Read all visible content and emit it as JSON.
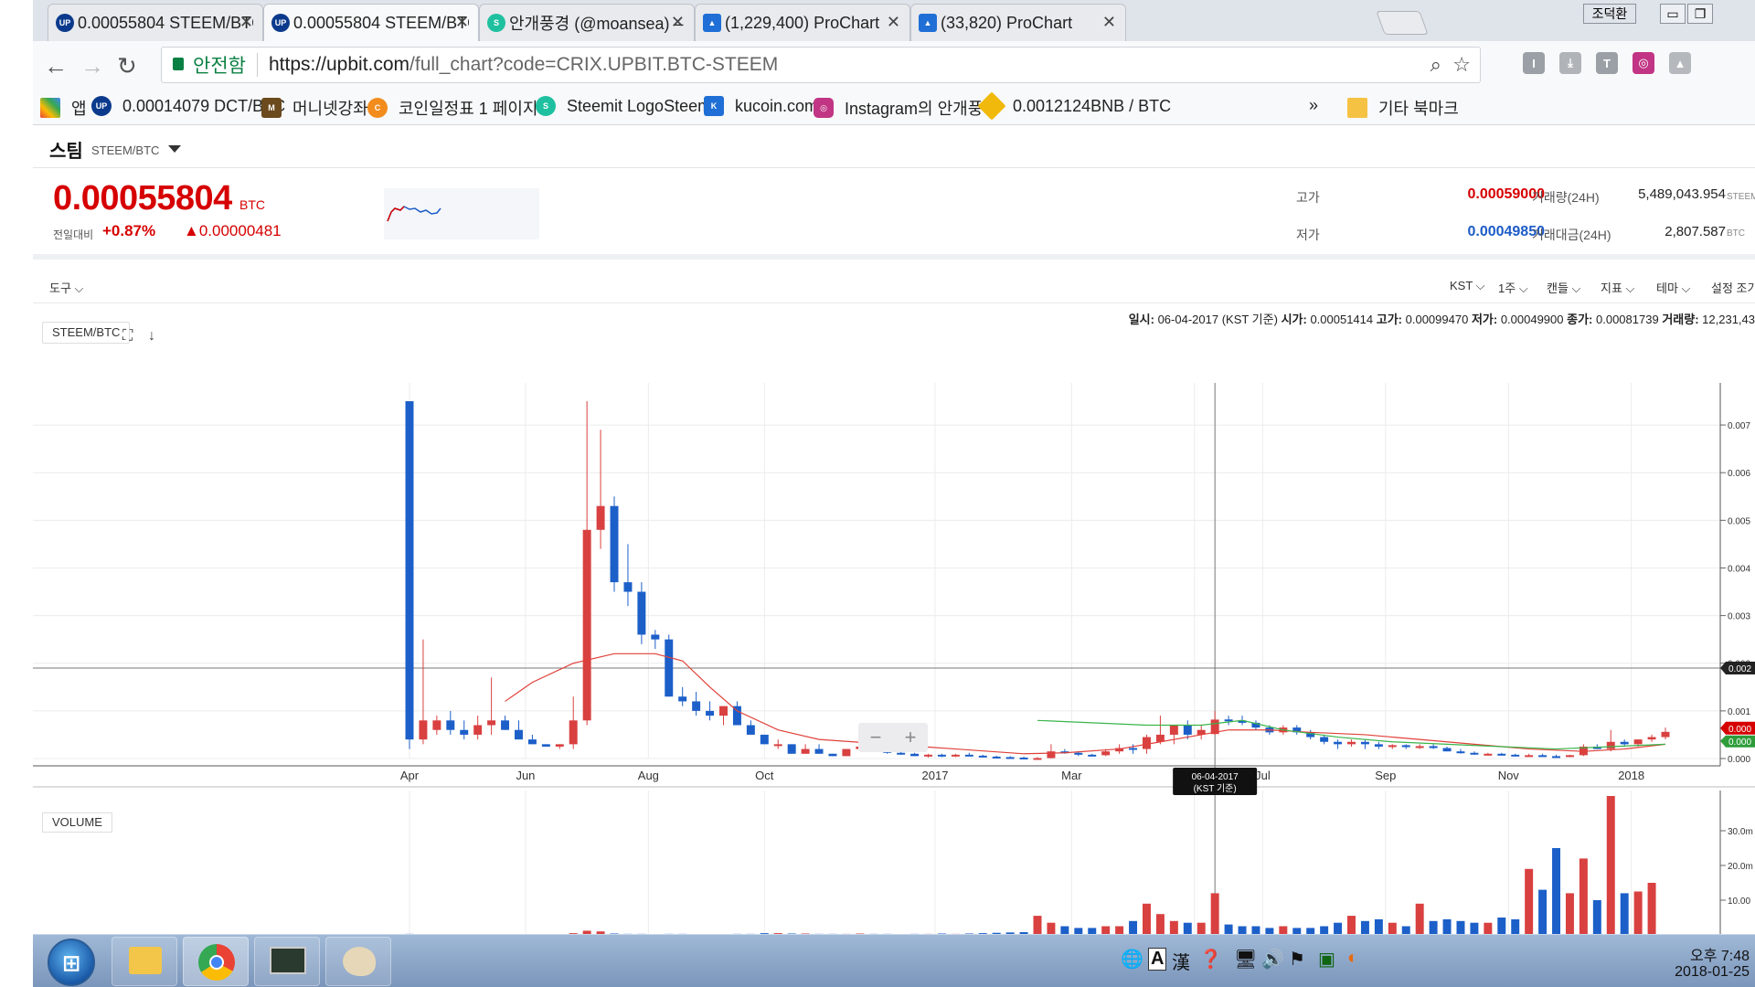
{
  "browser": {
    "tabs": [
      {
        "title": "0.00055804 STEEM/BTC",
        "icon": "upbit-icon",
        "active": false
      },
      {
        "title": "0.00055804 STEEM/BTC",
        "icon": "upbit-icon",
        "active": true
      },
      {
        "title": "안개풍경 (@moansea) –",
        "icon": "steemit-icon",
        "active": false
      },
      {
        "title": "(1,229,400) ProChart",
        "icon": "prochart-icon",
        "active": false
      },
      {
        "title": "(33,820) ProChart",
        "icon": "prochart-icon",
        "active": false
      }
    ],
    "user_badge": "조덕환",
    "secure_label": "안전함",
    "url_host": "https://upbit.com",
    "url_path": "/full_chart?code=CRIX.UPBIT.BTC-STEEM",
    "bookmarks": [
      {
        "label": "앱",
        "icon": "apps-grid-icon"
      },
      {
        "label": "0.00014079 DCT/BTC",
        "icon": "upbit-icon"
      },
      {
        "label": "머니넷강좌",
        "icon": "moneynet-icon"
      },
      {
        "label": "코인일정표 1 페이지",
        "icon": "coin-schedule-icon"
      },
      {
        "label": "Steemit LogoSteemit",
        "icon": "steemit-icon"
      },
      {
        "label": "kucoin.com",
        "icon": "kucoin-icon"
      },
      {
        "label": "Instagram의 안개풍경",
        "icon": "instagram-icon"
      },
      {
        "label": "0.0012124BNB / BTC",
        "icon": "binance-icon"
      }
    ],
    "bookmarks_overflow": "»",
    "other_bookmarks": "기타 북마크"
  },
  "coin": {
    "name": "스팀",
    "pair": "STEEM/BTC",
    "price": "0.00055804",
    "price_unit": "BTC",
    "change_label": "전일대비",
    "change_pct": "+0.87%",
    "change_abs": "▲0.00000481",
    "high_label": "고가",
    "high": "0.00059000",
    "low_label": "저가",
    "low": "0.00049850",
    "volume_label": "거래량(24H)",
    "volume": "5,489,043.954",
    "volume_unit": "STEEM",
    "value_label": "거래대금(24H)",
    "value": "2,807.587",
    "value_unit": "BTC"
  },
  "chart_toolbar": {
    "tools": "도구",
    "timezone": "KST",
    "interval": "1주",
    "candle": "캔들",
    "indicators": "지표",
    "theme": "테마",
    "settings": "설정 조기화"
  },
  "info_line": {
    "date_label": "일시:",
    "date": "06-04-2017 (KST 기준)",
    "open_label": "시가:",
    "open": "0.00051414",
    "high_label": "고가:",
    "high": "0.00099470",
    "low_label": "저가:",
    "low": "0.00049900",
    "close_label": "종가:",
    "close": "0.00081739",
    "vol_label": "거래량:",
    "vol": "12,231,43"
  },
  "symbol_button": "STEEM/BTC",
  "volume_button": "VOLUME",
  "crosshair_date": "06-04-2017",
  "crosshair_tz": "(KST 기준)",
  "crosshair_price": "0.002",
  "last_price_tag": "0.000",
  "colors": {
    "up": "#d94040",
    "down": "#1c5fc9",
    "ma_red": "#e0413a",
    "ma_green": "#39b54a",
    "price_red": "#d60000",
    "price_blue": "#1d5cc7"
  },
  "chart_data": {
    "type": "candlestick",
    "x_tick_labels": [
      "Apr",
      "Jun",
      "Aug",
      "Oct",
      "2017",
      "Mar",
      "May",
      "Jul",
      "Sep",
      "Nov",
      "2018"
    ],
    "y_tick_labels": [
      "0.007",
      "0.006",
      "0.005",
      "0.004",
      "0.003",
      "0.002",
      "0.001",
      "0.000"
    ],
    "ylim": [
      0,
      0.0075
    ],
    "volume_tick_labels": [
      "30.0m",
      "20.0m",
      "10.00"
    ],
    "candles": [
      {
        "o": 0.0075,
        "h": 0.0075,
        "l": 0.0002,
        "c": 0.0004
      },
      {
        "o": 0.0004,
        "h": 0.0025,
        "l": 0.0003,
        "c": 0.0008
      },
      {
        "o": 0.0006,
        "h": 0.0009,
        "l": 0.0005,
        "c": 0.0008
      },
      {
        "o": 0.0008,
        "h": 0.001,
        "l": 0.0005,
        "c": 0.0006
      },
      {
        "o": 0.0006,
        "h": 0.0008,
        "l": 0.0004,
        "c": 0.0005
      },
      {
        "o": 0.0005,
        "h": 0.0009,
        "l": 0.0004,
        "c": 0.0007
      },
      {
        "o": 0.0007,
        "h": 0.0017,
        "l": 0.0005,
        "c": 0.0008
      },
      {
        "o": 0.0008,
        "h": 0.0009,
        "l": 0.0006,
        "c": 0.0006
      },
      {
        "o": 0.0006,
        "h": 0.0008,
        "l": 0.0004,
        "c": 0.0004
      },
      {
        "o": 0.0004,
        "h": 0.0005,
        "l": 0.0003,
        "c": 0.0003
      },
      {
        "o": 0.0003,
        "h": 0.0003,
        "l": 0.00025,
        "c": 0.00025
      },
      {
        "o": 0.00025,
        "h": 0.0003,
        "l": 0.0002,
        "c": 0.0003
      },
      {
        "o": 0.0003,
        "h": 0.0013,
        "l": 0.0002,
        "c": 0.0008
      },
      {
        "o": 0.0008,
        "h": 0.0075,
        "l": 0.0007,
        "c": 0.0048
      },
      {
        "o": 0.0048,
        "h": 0.0069,
        "l": 0.0044,
        "c": 0.0053
      },
      {
        "o": 0.0053,
        "h": 0.0055,
        "l": 0.0035,
        "c": 0.0037
      },
      {
        "o": 0.0037,
        "h": 0.0045,
        "l": 0.0032,
        "c": 0.0035
      },
      {
        "o": 0.0035,
        "h": 0.0037,
        "l": 0.0024,
        "c": 0.0026
      },
      {
        "o": 0.0026,
        "h": 0.0027,
        "l": 0.0023,
        "c": 0.0025
      },
      {
        "o": 0.0025,
        "h": 0.0026,
        "l": 0.0013,
        "c": 0.0013
      },
      {
        "o": 0.0013,
        "h": 0.0015,
        "l": 0.0011,
        "c": 0.0012
      },
      {
        "o": 0.0012,
        "h": 0.0014,
        "l": 0.0009,
        "c": 0.001
      },
      {
        "o": 0.001,
        "h": 0.0012,
        "l": 0.0008,
        "c": 0.0009
      },
      {
        "o": 0.0009,
        "h": 0.0011,
        "l": 0.0007,
        "c": 0.0011
      },
      {
        "o": 0.0011,
        "h": 0.0012,
        "l": 0.0007,
        "c": 0.0007
      },
      {
        "o": 0.0007,
        "h": 0.0008,
        "l": 0.0005,
        "c": 0.0005
      },
      {
        "o": 0.0005,
        "h": 0.0005,
        "l": 0.0003,
        "c": 0.0003
      },
      {
        "o": 0.0003,
        "h": 0.0004,
        "l": 0.0002,
        "c": 0.0003
      },
      {
        "o": 0.0003,
        "h": 0.0003,
        "l": 0.0001,
        "c": 0.0001
      },
      {
        "o": 0.0001,
        "h": 0.0003,
        "l": 0.0001,
        "c": 0.0002
      },
      {
        "o": 0.0002,
        "h": 0.0003,
        "l": 0.0001,
        "c": 0.0001
      },
      {
        "o": 0.0001,
        "h": 0.0001,
        "l": 5e-05,
        "c": 5e-05
      },
      {
        "o": 5e-05,
        "h": 0.0002,
        "l": 5e-05,
        "c": 0.0002
      },
      {
        "o": 0.0002,
        "h": 0.0003,
        "l": 0.00015,
        "c": 0.00025
      },
      {
        "o": 0.00025,
        "h": 0.0003,
        "l": 0.00015,
        "c": 0.0002
      },
      {
        "o": 0.0002,
        "h": 0.0002,
        "l": 0.0001,
        "c": 0.00012
      },
      {
        "o": 0.00012,
        "h": 0.00015,
        "l": 8e-05,
        "c": 0.0001
      },
      {
        "o": 0.0001,
        "h": 0.00012,
        "l": 5e-05,
        "c": 5e-05
      },
      {
        "o": 5e-05,
        "h": 0.0001,
        "l": 2e-05,
        "c": 8e-05
      },
      {
        "o": 8e-05,
        "h": 0.0001,
        "l": 3e-05,
        "c": 5e-05
      },
      {
        "o": 5e-05,
        "h": 0.0001,
        "l": 3e-05,
        "c": 8e-05
      },
      {
        "o": 8e-05,
        "h": 0.00012,
        "l": 5e-05,
        "c": 6e-05
      },
      {
        "o": 6e-05,
        "h": 8e-05,
        "l": 3e-05,
        "c": 4e-05
      },
      {
        "o": 4e-05,
        "h": 6e-05,
        "l": 0.0,
        "c": 3e-05
      },
      {
        "o": 3e-05,
        "h": 5e-05,
        "l": 0.0,
        "c": 2e-05
      },
      {
        "o": 2e-05,
        "h": 4e-05,
        "l": 0.0,
        "c": 1e-05
      },
      {
        "o": 1e-05,
        "h": 3e-05,
        "l": 0.0,
        "c": 1e-05
      },
      {
        "o": 1e-05,
        "h": 0.0003,
        "l": 0.0,
        "c": 0.00015
      },
      {
        "o": 0.00015,
        "h": 0.0002,
        "l": 0.0001,
        "c": 0.00012
      },
      {
        "o": 0.00012,
        "h": 0.00015,
        "l": 5e-05,
        "c": 8e-05
      },
      {
        "o": 8e-05,
        "h": 0.0001,
        "l": 5e-05,
        "c": 7e-05
      },
      {
        "o": 7e-05,
        "h": 0.0002,
        "l": 5e-05,
        "c": 0.00015
      },
      {
        "o": 0.00015,
        "h": 0.0003,
        "l": 0.0001,
        "c": 0.00022
      },
      {
        "o": 0.00022,
        "h": 0.0003,
        "l": 0.0001,
        "c": 0.0002
      },
      {
        "o": 0.0002,
        "h": 0.0005,
        "l": 0.0001,
        "c": 0.00045
      },
      {
        "o": 0.00035,
        "h": 0.0009,
        "l": 0.0003,
        "c": 0.0005
      },
      {
        "o": 0.0005,
        "h": 0.0007,
        "l": 0.0003,
        "c": 0.0007
      },
      {
        "o": 0.0007,
        "h": 0.0008,
        "l": 0.0004,
        "c": 0.0005
      },
      {
        "o": 0.0005,
        "h": 0.0007,
        "l": 0.0004,
        "c": 0.0006
      },
      {
        "o": 0.00051414,
        "h": 0.0009947,
        "l": 0.000499,
        "c": 0.00081739
      },
      {
        "o": 0.00082,
        "h": 0.0009,
        "l": 0.0007,
        "c": 0.0008
      },
      {
        "o": 0.0008,
        "h": 0.0009,
        "l": 0.0007,
        "c": 0.00075
      },
      {
        "o": 0.00075,
        "h": 0.0008,
        "l": 0.0006,
        "c": 0.00065
      },
      {
        "o": 0.00065,
        "h": 0.0007,
        "l": 0.0005,
        "c": 0.00055
      },
      {
        "o": 0.00055,
        "h": 0.0007,
        "l": 0.0005,
        "c": 0.00065
      },
      {
        "o": 0.00065,
        "h": 0.0007,
        "l": 0.0005,
        "c": 0.00055
      },
      {
        "o": 0.00055,
        "h": 0.0006,
        "l": 0.0004,
        "c": 0.00045
      },
      {
        "o": 0.00045,
        "h": 0.0005,
        "l": 0.0003,
        "c": 0.00035
      },
      {
        "o": 0.00035,
        "h": 0.0004,
        "l": 0.0002,
        "c": 0.0003
      },
      {
        "o": 0.0003,
        "h": 0.0004,
        "l": 0.00025,
        "c": 0.00035
      },
      {
        "o": 0.00035,
        "h": 0.0004,
        "l": 0.0002,
        "c": 0.0003
      },
      {
        "o": 0.0003,
        "h": 0.00035,
        "l": 0.0002,
        "c": 0.00025
      },
      {
        "o": 0.00025,
        "h": 0.0003,
        "l": 0.0002,
        "c": 0.00028
      },
      {
        "o": 0.00028,
        "h": 0.0003,
        "l": 0.0002,
        "c": 0.00024
      },
      {
        "o": 0.00024,
        "h": 0.0003,
        "l": 0.0002,
        "c": 0.00026
      },
      {
        "o": 0.00026,
        "h": 0.0003,
        "l": 0.0002,
        "c": 0.00022
      },
      {
        "o": 0.00022,
        "h": 0.00025,
        "l": 0.00015,
        "c": 0.00015
      },
      {
        "o": 0.00015,
        "h": 0.0002,
        "l": 0.0001,
        "c": 0.00012
      },
      {
        "o": 0.00012,
        "h": 0.00015,
        "l": 8e-05,
        "c": 0.0001
      },
      {
        "o": 0.0001,
        "h": 0.00012,
        "l": 8e-05,
        "c": 0.0001
      },
      {
        "o": 0.0001,
        "h": 0.00012,
        "l": 6e-05,
        "c": 8e-05
      },
      {
        "o": 8e-05,
        "h": 0.0001,
        "l": 5e-05,
        "c": 6e-05
      },
      {
        "o": 6e-05,
        "h": 0.0001,
        "l": 4e-05,
        "c": 7e-05
      },
      {
        "o": 7e-05,
        "h": 0.0001,
        "l": 4e-05,
        "c": 5e-05
      },
      {
        "o": 5e-05,
        "h": 8e-05,
        "l": 3e-05,
        "c": 4e-05
      },
      {
        "o": 4e-05,
        "h": 8e-05,
        "l": 3e-05,
        "c": 7e-05
      },
      {
        "o": 7e-05,
        "h": 0.0003,
        "l": 5e-05,
        "c": 0.00025
      },
      {
        "o": 0.00025,
        "h": 0.0003,
        "l": 0.0002,
        "c": 0.0002
      },
      {
        "o": 0.0002,
        "h": 0.0006,
        "l": 0.00015,
        "c": 0.00035
      },
      {
        "o": 0.00035,
        "h": 0.0004,
        "l": 0.00025,
        "c": 0.0003
      },
      {
        "o": 0.0003,
        "h": 0.0004,
        "l": 0.00025,
        "c": 0.0004
      },
      {
        "o": 0.0004,
        "h": 0.0005,
        "l": 0.00035,
        "c": 0.00045
      },
      {
        "o": 0.00045,
        "h": 0.00065,
        "l": 0.0004,
        "c": 0.00056
      }
    ],
    "ma_red": [
      [
        7,
        0.0012
      ],
      [
        9,
        0.0016
      ],
      [
        12,
        0.002
      ],
      [
        15,
        0.0022
      ],
      [
        18,
        0.0022
      ],
      [
        20,
        0.00205
      ],
      [
        22,
        0.0015
      ],
      [
        24,
        0.001
      ],
      [
        27,
        0.0006
      ],
      [
        30,
        0.0004
      ],
      [
        35,
        0.0003
      ],
      [
        40,
        0.0002
      ],
      [
        45,
        0.0001
      ],
      [
        48,
        0.00012
      ],
      [
        52,
        0.0002
      ],
      [
        55,
        0.00035
      ],
      [
        58,
        0.0005
      ],
      [
        60,
        0.0006
      ],
      [
        63,
        0.0006
      ],
      [
        66,
        0.00055
      ],
      [
        70,
        0.0005
      ],
      [
        74,
        0.0004
      ],
      [
        78,
        0.0003
      ],
      [
        82,
        0.0002
      ],
      [
        86,
        0.00015
      ],
      [
        89,
        0.0002
      ],
      [
        92,
        0.0003
      ]
    ],
    "ma_green": [
      [
        46,
        0.0008
      ],
      [
        50,
        0.00075
      ],
      [
        54,
        0.0007
      ],
      [
        58,
        0.0007
      ],
      [
        61,
        0.0008
      ],
      [
        64,
        0.0006
      ],
      [
        68,
        0.00045
      ],
      [
        72,
        0.00035
      ],
      [
        76,
        0.0003
      ],
      [
        80,
        0.00025
      ],
      [
        84,
        0.0002
      ],
      [
        88,
        0.00025
      ],
      [
        92,
        0.0003
      ]
    ],
    "volumes": [
      1,
      1,
      1,
      1,
      1,
      1,
      1,
      1,
      1,
      1,
      1,
      1,
      1,
      2,
      1,
      1,
      1,
      1,
      1,
      1,
      1,
      1,
      1,
      1,
      1,
      1,
      1,
      1,
      1,
      1,
      1,
      1,
      1,
      1,
      1,
      1,
      1,
      1,
      1,
      1,
      1,
      1,
      1,
      1,
      1,
      1,
      1,
      1,
      1,
      1,
      1,
      1,
      1,
      1,
      1,
      1,
      2,
      1,
      1,
      1,
      1,
      1,
      1,
      1,
      1,
      1,
      1,
      1,
      1,
      1,
      1,
      1,
      1,
      1,
      1,
      1,
      1,
      1,
      1,
      1,
      1,
      1,
      1,
      1,
      1,
      1,
      1,
      1,
      1,
      1,
      1,
      1,
      1
    ]
  },
  "volume_data": [
    0.3,
    0.2,
    0.2,
    0.2,
    0.2,
    0.2,
    0.2,
    0.2,
    0.2,
    0.2,
    0.2,
    0.2,
    0.5,
    1.2,
    1.0,
    0.4,
    0.3,
    0.3,
    0.2,
    0.3,
    0.3,
    0.2,
    0.2,
    0.2,
    0.3,
    0.3,
    0.5,
    0.5,
    0.4,
    0.4,
    0.3,
    0.3,
    0.3,
    0.4,
    0.3,
    0.3,
    0.2,
    0.3,
    0.3,
    0.4,
    0.3,
    0.4,
    0.5,
    0.6,
    0.7,
    0.8,
    5.5,
    3.5,
    2.5,
    2.0,
    2.0,
    2.5,
    2.5,
    4.0,
    9.0,
    6.0,
    4.0,
    3.5,
    3.5,
    12.0,
    3.0,
    2.5,
    2.5,
    2.0,
    2.5,
    2.0,
    2.0,
    2.5,
    3.5,
    5.5,
    4.0,
    4.5,
    3.5,
    2.5,
    9.0,
    4.0,
    4.5,
    4.0,
    3.5,
    3.5,
    5.0,
    4.5,
    19.0,
    13.0,
    25.0,
    12.0,
    22.0,
    10.0,
    40.0,
    12.0,
    12.5,
    15.0
  ],
  "taskbar": {
    "clock_time": "오후 7:48",
    "clock_date": "2018-01-25"
  }
}
